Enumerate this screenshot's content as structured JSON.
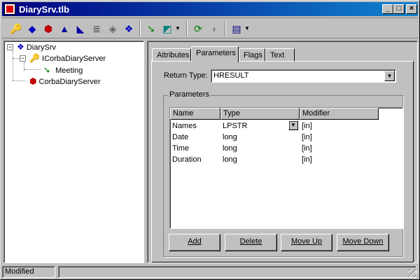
{
  "window": {
    "title": "DiarySrv.tlb"
  },
  "titlebar_buttons": {
    "minimize": "_",
    "maximize": "□",
    "close": "×"
  },
  "toolbar": {
    "tools": [
      {
        "name": "new-interface-icon",
        "glyph": "🔑",
        "color": "#c00000"
      },
      {
        "name": "new-dispinterface-icon",
        "glyph": "◆",
        "color": "#0000c0"
      },
      {
        "name": "new-coclass-icon",
        "glyph": "⬢",
        "color": "#c00000"
      },
      {
        "name": "new-enum-icon",
        "glyph": "▲",
        "color": "#0000a0"
      },
      {
        "name": "new-alias-icon",
        "glyph": "◣",
        "color": "#0000a0"
      },
      {
        "name": "new-record-icon",
        "glyph": "≣",
        "color": "#404040"
      },
      {
        "name": "new-union-icon",
        "glyph": "◈",
        "color": "#606060"
      },
      {
        "name": "new-module-icon",
        "glyph": "❖",
        "color": "#0000c0"
      },
      {
        "name": "new-method-icon",
        "glyph": "➘",
        "color": "#008000"
      },
      {
        "name": "new-property-icon",
        "glyph": "◩",
        "color": "#008080"
      },
      {
        "name": "refresh-icon",
        "glyph": "⟳",
        "color": "#008000"
      },
      {
        "name": "register-icon",
        "glyph": "◗",
        "color": "#808080"
      },
      {
        "name": "export-icon",
        "glyph": "▤",
        "color": "#000080"
      }
    ],
    "dropdown_arrow": "▼"
  },
  "tree": {
    "root": "DiarySrv",
    "interface": "ICorbaDiaryServer",
    "method": "Meeting",
    "coclass": "CorbaDiaryServer",
    "expand_symbol": "−"
  },
  "tabs": [
    "Attributes",
    "Parameters",
    "Flags",
    "Text"
  ],
  "active_tab": "Parameters",
  "return_type": {
    "label": "Return Type:",
    "value": "HRESULT",
    "arrow": "▼"
  },
  "parameters": {
    "group_label": "Parameters",
    "columns": [
      "Name",
      "Type",
      "Modifier"
    ],
    "rows": [
      {
        "name": "Names",
        "type": "LPSTR",
        "modifier": "[in]"
      },
      {
        "name": "Date",
        "type": "long",
        "modifier": "[in]"
      },
      {
        "name": "Time",
        "type": "long",
        "modifier": "[in]"
      },
      {
        "name": "Duration",
        "type": "long",
        "modifier": "[in]"
      }
    ],
    "cell_arrow": "▼"
  },
  "buttons": {
    "add": "Add",
    "delete": "Delete",
    "move_up": "Move Up",
    "move_down": "Move Down"
  },
  "status": {
    "text": "Modified"
  }
}
